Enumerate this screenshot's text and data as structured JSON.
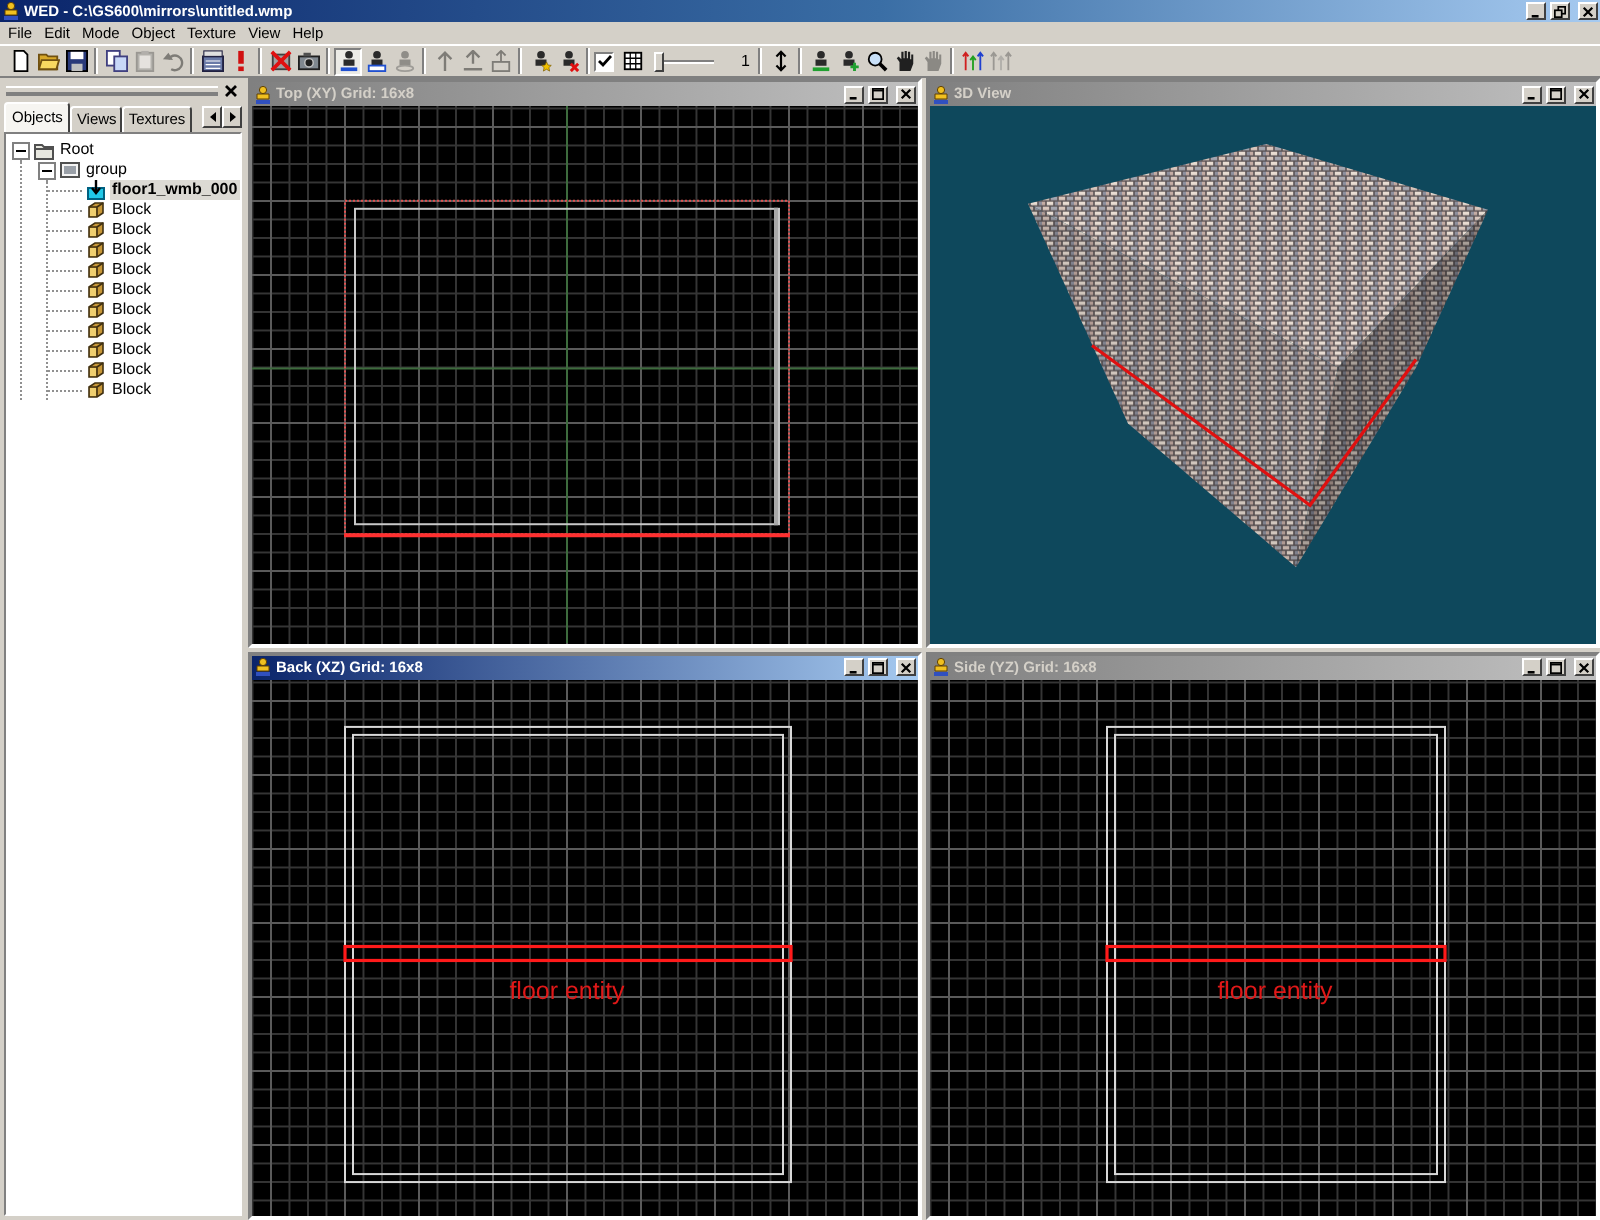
{
  "window": {
    "title": "WED - C:\\GS600\\mirrors\\untitled.wmp"
  },
  "menu": [
    "File",
    "Edit",
    "Mode",
    "Object",
    "Texture",
    "View",
    "Help"
  ],
  "toolbar": {
    "groups": [
      {
        "kind": "buttons",
        "buttons": [
          {
            "kind": "page",
            "disabled": false,
            "pressed": false
          },
          {
            "kind": "folder",
            "disabled": false,
            "pressed": false
          },
          {
            "kind": "floppy",
            "disabled": false,
            "pressed": false
          }
        ]
      },
      {
        "kind": "buttons",
        "buttons": [
          {
            "kind": "pages",
            "disabled": false,
            "pressed": false
          },
          {
            "kind": "clipboard",
            "disabled": true,
            "pressed": false
          },
          {
            "kind": "curved_arrow",
            "disabled": true,
            "pressed": false
          }
        ]
      },
      {
        "kind": "buttons",
        "buttons": [
          {
            "kind": "film",
            "disabled": false,
            "pressed": false
          },
          {
            "kind": "exclamation",
            "disabled": false,
            "pressed": false
          }
        ]
      },
      {
        "kind": "buttons",
        "buttons": [
          {
            "kind": "cross_box",
            "disabled": false,
            "pressed": false
          },
          {
            "kind": "camera",
            "disabled": false,
            "pressed": false
          }
        ]
      },
      {
        "kind": "buttons",
        "buttons": [
          {
            "kind": "figure_arrow",
            "disabled": false,
            "pressed": true
          },
          {
            "kind": "figure_box",
            "disabled": false,
            "pressed": false
          },
          {
            "kind": "figure_ring",
            "disabled": true,
            "pressed": false
          }
        ]
      },
      {
        "kind": "buttons",
        "buttons": [
          {
            "kind": "arrow",
            "disabled": true,
            "pressed": false
          },
          {
            "kind": "arrow_split",
            "disabled": true,
            "pressed": false
          },
          {
            "kind": "arrow_box",
            "disabled": true,
            "pressed": false
          }
        ]
      },
      {
        "kind": "buttons",
        "buttons": [
          {
            "kind": "figure_star",
            "disabled": false,
            "pressed": false
          },
          {
            "kind": "figure_cross",
            "disabled": false,
            "pressed": false
          }
        ]
      },
      {
        "kind": "snap",
        "checked": true,
        "level": 0,
        "reading": "1"
      },
      {
        "kind": "buttons",
        "buttons": [
          {
            "kind": "vertical_arrows",
            "disabled": false,
            "pressed": false
          }
        ]
      },
      {
        "kind": "buttons",
        "buttons": [
          {
            "kind": "figure_plus",
            "disabled": false,
            "pressed": false
          },
          {
            "kind": "figure_add",
            "disabled": false,
            "pressed": false
          },
          {
            "kind": "magnifier",
            "disabled": false,
            "pressed": false
          },
          {
            "kind": "hand",
            "disabled": false,
            "pressed": false
          },
          {
            "kind": "hand",
            "disabled": true,
            "pressed": false
          }
        ]
      },
      {
        "kind": "buttons",
        "buttons": [
          {
            "kind": "axis_arrows",
            "disabled": false,
            "pressed": false
          },
          {
            "kind": "axis_arrows",
            "disabled": true,
            "pressed": false
          }
        ]
      }
    ]
  },
  "sidebar": {
    "tabs": [
      {
        "label": "Objects",
        "selected": true
      },
      {
        "label": "Views",
        "selected": false
      },
      {
        "label": "Textures",
        "selected": false
      }
    ],
    "tree": [
      {
        "label": "Root",
        "kind": "root",
        "expanded": true,
        "selected": false,
        "children": [
          {
            "label": "group",
            "kind": "group",
            "expanded": true,
            "selected": false,
            "children": [
              {
                "label": "floor1_wmb_000",
                "kind": "entity",
                "selected": true
              },
              {
                "label": "Block",
                "kind": "block",
                "selected": false
              },
              {
                "label": "Block",
                "kind": "block",
                "selected": false
              },
              {
                "label": "Block",
                "kind": "block",
                "selected": false
              },
              {
                "label": "Block",
                "kind": "block",
                "selected": false
              },
              {
                "label": "Block",
                "kind": "block",
                "selected": false
              },
              {
                "label": "Block",
                "kind": "block",
                "selected": false
              },
              {
                "label": "Block",
                "kind": "block",
                "selected": false
              },
              {
                "label": "Block",
                "kind": "block",
                "selected": false
              },
              {
                "label": "Block",
                "kind": "block",
                "selected": false
              },
              {
                "label": "Block",
                "kind": "block",
                "selected": false
              }
            ]
          }
        ]
      }
    ]
  },
  "viewports": [
    {
      "title": "Top (XY) Grid: 16x8",
      "kind": "top",
      "selected": false
    },
    {
      "title": "3D View",
      "kind": "perspective",
      "selected": false
    },
    {
      "title": "Back (XZ) Grid: 16x8",
      "kind": "back",
      "selected": true,
      "label": "floor entity"
    },
    {
      "title": "Side (YZ) Grid: 16x8",
      "kind": "side",
      "selected": false,
      "label": "floor entity"
    }
  ]
}
